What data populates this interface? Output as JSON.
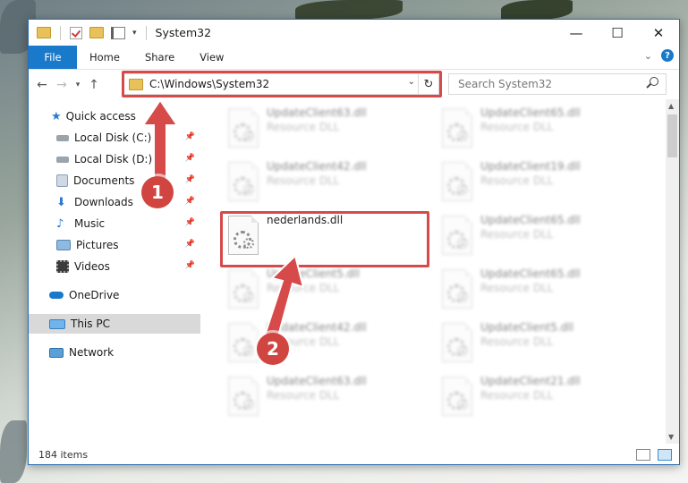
{
  "window": {
    "title": "System32",
    "controls": {
      "minimize": "—",
      "maximize": "☐",
      "close": "✕"
    }
  },
  "ribbon": {
    "tabs": [
      "File",
      "Home",
      "Share",
      "View"
    ],
    "expand_icon": "chevron-down-icon",
    "help_label": "?"
  },
  "address_bar": {
    "path": "C:\\Windows\\System32",
    "refresh_glyph": "↻"
  },
  "search": {
    "placeholder": "Search System32"
  },
  "sidebar": {
    "items": [
      {
        "label": "Quick access",
        "icon": "star-icon"
      },
      {
        "label": "Local Disk (C:)",
        "icon": "drive-icon",
        "pinned": true
      },
      {
        "label": "Local Disk (D:)",
        "icon": "drive-icon",
        "pinned": true
      },
      {
        "label": "Documents",
        "icon": "documents-icon",
        "pinned": true
      },
      {
        "label": "Downloads",
        "icon": "downloads-icon",
        "pinned": true
      },
      {
        "label": "Music",
        "icon": "music-icon",
        "pinned": true
      },
      {
        "label": "Pictures",
        "icon": "pictures-icon",
        "pinned": true
      },
      {
        "label": "Videos",
        "icon": "videos-icon",
        "pinned": true
      },
      {
        "label": "OneDrive",
        "icon": "cloud-icon"
      },
      {
        "label": "This PC",
        "icon": "computer-icon",
        "selected": true
      },
      {
        "label": "Network",
        "icon": "network-icon"
      }
    ]
  },
  "files": [
    {
      "name": "UpdateClient63.dll",
      "type": "Resource DLL",
      "dimmed": true
    },
    {
      "name": "UpdateClient65.dll",
      "type": "Resource DLL",
      "dimmed": true
    },
    {
      "name": "UpdateClient42.dll",
      "type": "Resource DLL",
      "dimmed": true
    },
    {
      "name": "UpdateClient19.dll",
      "type": "Resource DLL",
      "dimmed": true
    },
    {
      "name": "nederlands.dll",
      "type": "",
      "dimmed": false
    },
    {
      "name": "UpdateClient65.dll",
      "type": "Resource DLL",
      "dimmed": true
    },
    {
      "name": "UpdateClient5.dll",
      "type": "Resource DLL",
      "dimmed": true
    },
    {
      "name": "UpdateClient65.dll",
      "type": "Resource DLL",
      "dimmed": true
    },
    {
      "name": "UpdateClient42.dll",
      "type": "Resource DLL",
      "dimmed": true
    },
    {
      "name": "UpdateClient5.dll",
      "type": "Resource DLL",
      "dimmed": true
    },
    {
      "name": "UpdateClient63.dll",
      "type": "Resource DLL",
      "dimmed": true
    },
    {
      "name": "UpdateClient21.dll",
      "type": "Resource DLL",
      "dimmed": true
    }
  ],
  "status": {
    "item_count": "184 items"
  },
  "annotations": {
    "step1": "1",
    "step2": "2",
    "highlight_color": "#d64a4a",
    "badge_color": "#d0453f"
  },
  "colors": {
    "accent": "#1979ca",
    "selection": "#d9d9d9"
  }
}
